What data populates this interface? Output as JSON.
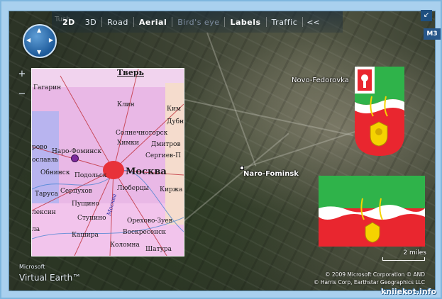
{
  "toolbar": {
    "ghost": "Tush",
    "items": [
      {
        "label": "2D",
        "style": "bold"
      },
      {
        "label": "3D",
        "style": "normal"
      },
      {
        "label": "Road",
        "style": "normal"
      },
      {
        "label": "Aerial",
        "style": "bold"
      },
      {
        "label": "Bird's eye",
        "style": "dim"
      },
      {
        "label": "Labels",
        "style": "bold"
      },
      {
        "label": "Traffic",
        "style": "normal"
      }
    ],
    "collapse": "<<"
  },
  "controls": {
    "compass_icon": "pan-compass-icon",
    "zoom_in": "+",
    "zoom_out": "−",
    "corner": "↙",
    "mz": "M3"
  },
  "inset_map": {
    "labels": {
      "tver": "Тверь",
      "gagarin": "Гагарин",
      "klin": "Клин",
      "kim": "Ким",
      "dubna": "Дубна",
      "solnechnogorsk": "Солнечногорск",
      "khimki": "Химки",
      "dmitrov": "Дмитров",
      "sergiev": "Сергиев-П",
      "rovo": "рово",
      "naro_fominsk": "Наро-Фоминск",
      "oslavl": "ославль",
      "obninsk": "Обнинск",
      "podolsk": "Подольск",
      "moskva": "Москва",
      "moskva_river": "Москва",
      "tarusa": "Таруса",
      "serpukhov": "Серпухов",
      "lyubertsy": "Люберцы",
      "kirzh": "Киржа",
      "pushchino": "Пущино",
      "lexin": "лексин",
      "stupino": "Ступино",
      "orekhovo": "Орехово-Зуев",
      "la": "ла",
      "kashira": "Кашира",
      "voskresensk": "Воскресенск",
      "kolomna": "Коломна",
      "shatura": "Шатура"
    }
  },
  "places": {
    "novo_fedorovka": "Novo-Fedorovka",
    "naro_fominsk": "Naro-Fominsk"
  },
  "scale": "2 miles",
  "logo": {
    "line1": "Microsoft",
    "line2": "Virtual Earth™"
  },
  "attribution": {
    "line1": "© 2009 Microsoft Corporation   © AND",
    "line2": "© Harris Corp, Earthstar Geographics LLC"
  },
  "watermark": "kniiekot.info",
  "colors": {
    "flag_green": "#2fb34a",
    "flag_white": "#ffffff",
    "flag_red": "#e9262f",
    "emblem_gold": "#f5d300"
  }
}
